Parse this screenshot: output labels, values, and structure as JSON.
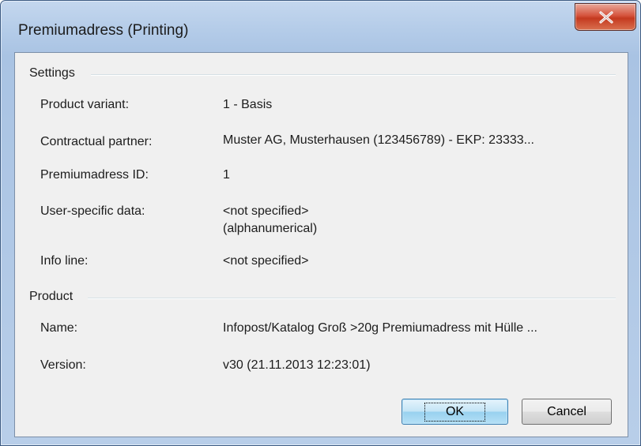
{
  "window": {
    "title": "Premiumadress (Printing)"
  },
  "settings": {
    "group_label": "Settings",
    "fields": [
      {
        "label": "Product variant:",
        "value": "1 - Basis"
      },
      {
        "label": "Contractual partner:",
        "value": "Muster AG, Musterhausen (123456789) - EKP: 23333..."
      },
      {
        "label": "Premiumadress ID:",
        "value": "1"
      },
      {
        "label": "User-specific data:",
        "value": "<not specified>",
        "value_line2": "(alphanumerical)"
      },
      {
        "label": "Info line:",
        "value": "<not specified>"
      }
    ]
  },
  "product": {
    "group_label": "Product",
    "fields": [
      {
        "label": "Name:",
        "value": "Infopost/Katalog Groß >20g Premiumadress mit Hülle ..."
      },
      {
        "label": "Version:",
        "value": "v30 (21.11.2013 12:23:01)"
      }
    ]
  },
  "buttons": {
    "ok": "OK",
    "cancel": "Cancel"
  },
  "icons": {
    "close": "close-icon"
  }
}
